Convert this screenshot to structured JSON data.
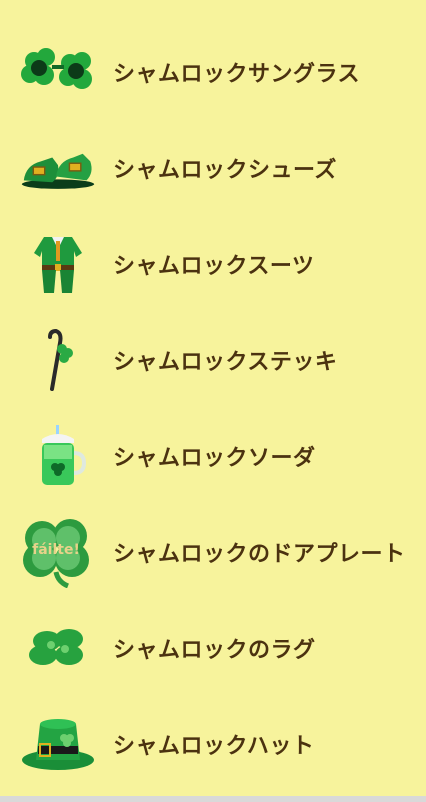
{
  "items": [
    {
      "icon": "shamrock-sunglasses-icon",
      "label": "シャムロックサングラス"
    },
    {
      "icon": "shamrock-shoes-icon",
      "label": "シャムロックシューズ"
    },
    {
      "icon": "shamrock-suit-icon",
      "label": "シャムロックスーツ"
    },
    {
      "icon": "shamrock-cane-icon",
      "label": "シャムロックステッキ"
    },
    {
      "icon": "shamrock-soda-icon",
      "label": "シャムロックソーダ"
    },
    {
      "icon": "shamrock-door-plate-icon",
      "label": "シャムロックのドアプレート",
      "sign_text": "fáilte!"
    },
    {
      "icon": "shamrock-rug-icon",
      "label": "シャムロックのラグ"
    },
    {
      "icon": "shamrock-hat-icon",
      "label": "シャムロックハット"
    }
  ],
  "colors": {
    "background": "#f7f39c",
    "text": "#4b3210",
    "green": "#1e9a3a",
    "dark_green": "#0d6a28"
  }
}
